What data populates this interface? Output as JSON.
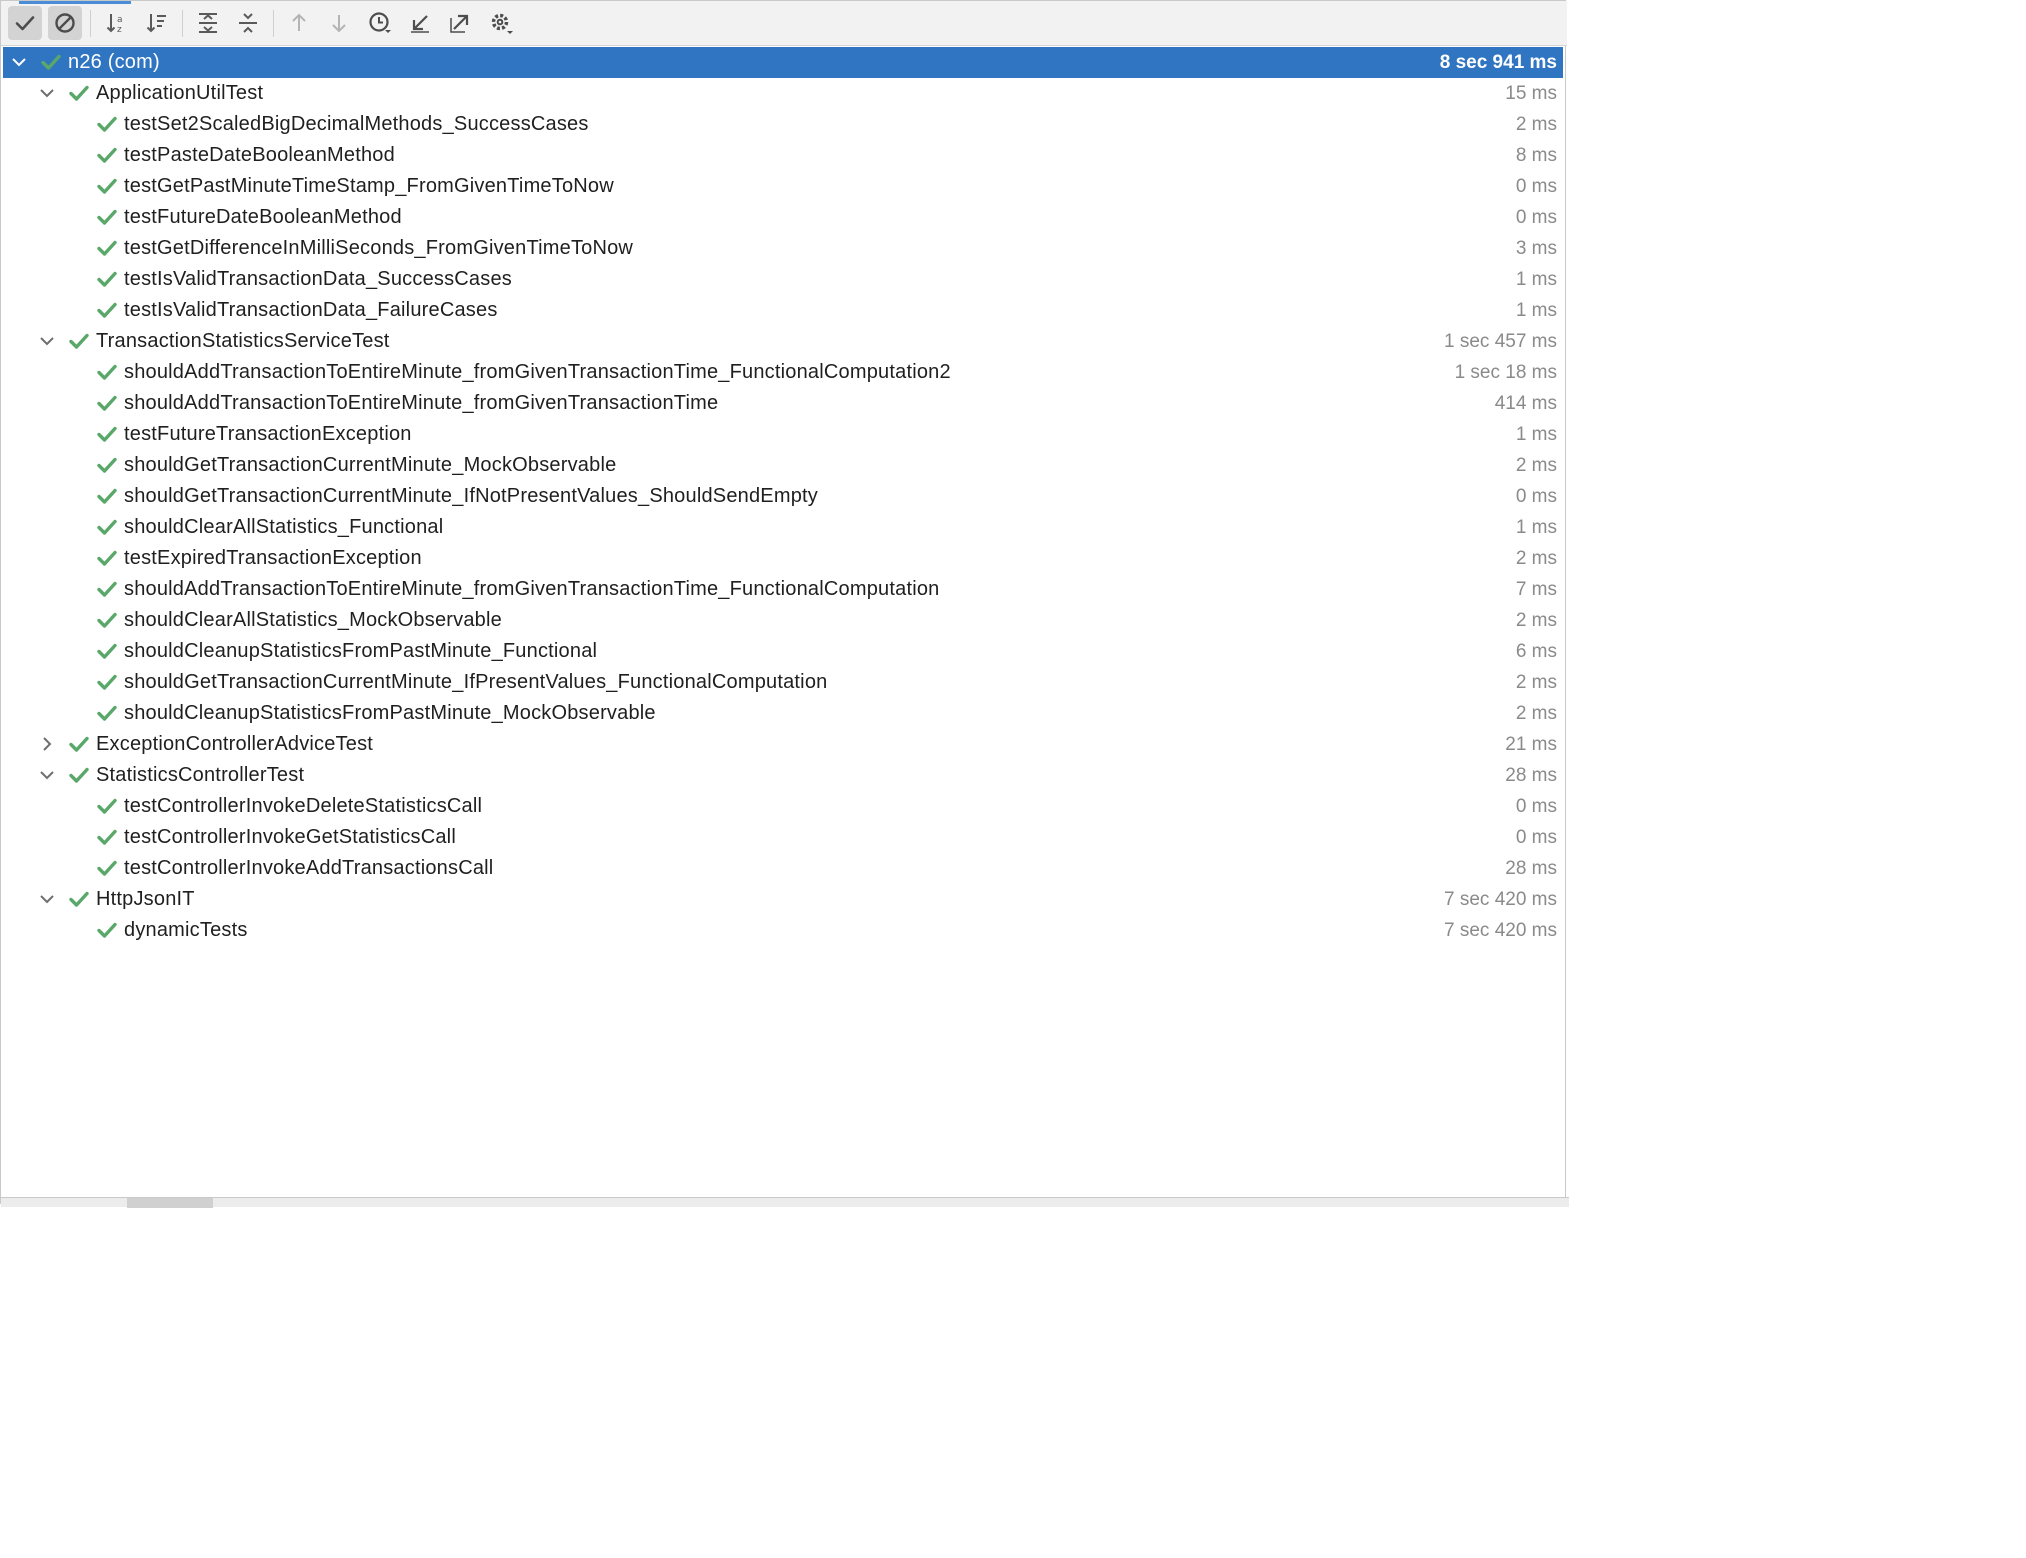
{
  "toolbar": {
    "buttons": [
      {
        "icon": "show-passed-icon",
        "active": true
      },
      {
        "icon": "show-ignored-icon",
        "active": true
      },
      {
        "icon": "sort-alphabetically-icon",
        "active": false
      },
      {
        "icon": "sort-by-duration-icon",
        "active": false
      },
      {
        "icon": "expand-all-icon",
        "active": false
      },
      {
        "icon": "collapse-all-icon",
        "active": false
      },
      {
        "icon": "previous-failed-test-icon",
        "active": false
      },
      {
        "icon": "next-failed-test-icon",
        "active": false
      },
      {
        "icon": "test-history-icon",
        "active": false
      },
      {
        "icon": "import-tests-icon",
        "active": false
      },
      {
        "icon": "export-test-results-icon",
        "active": false
      },
      {
        "icon": "settings-gear-icon",
        "active": false
      }
    ]
  },
  "colors": {
    "pass_green": "#59a869",
    "selection_blue": "#2f75c1",
    "duration_gray": "#8a8a8a"
  },
  "tests": {
    "root": {
      "label": "n26 (com)",
      "duration": "8 sec 941 ms"
    },
    "suites": [
      {
        "label": "ApplicationUtilTest",
        "duration": "15 ms",
        "expanded": true,
        "tests": [
          {
            "label": "testSet2ScaledBigDecimalMethods_SuccessCases",
            "duration": "2 ms"
          },
          {
            "label": "testPasteDateBooleanMethod",
            "duration": "8 ms"
          },
          {
            "label": "testGetPastMinuteTimeStamp_FromGivenTimeToNow",
            "duration": "0 ms"
          },
          {
            "label": "testFutureDateBooleanMethod",
            "duration": "0 ms"
          },
          {
            "label": "testGetDifferenceInMilliSeconds_FromGivenTimeToNow",
            "duration": "3 ms"
          },
          {
            "label": "testIsValidTransactionData_SuccessCases",
            "duration": "1 ms"
          },
          {
            "label": "testIsValidTransactionData_FailureCases",
            "duration": "1 ms"
          }
        ]
      },
      {
        "label": "TransactionStatisticsServiceTest",
        "duration": "1 sec 457 ms",
        "expanded": true,
        "tests": [
          {
            "label": "shouldAddTransactionToEntireMinute_fromGivenTransactionTime_FunctionalComputation2",
            "duration": "1 sec 18 ms"
          },
          {
            "label": "shouldAddTransactionToEntireMinute_fromGivenTransactionTime",
            "duration": "414 ms"
          },
          {
            "label": "testFutureTransactionException",
            "duration": "1 ms"
          },
          {
            "label": "shouldGetTransactionCurrentMinute_MockObservable",
            "duration": "2 ms"
          },
          {
            "label": "shouldGetTransactionCurrentMinute_IfNotPresentValues_ShouldSendEmpty",
            "duration": "0 ms"
          },
          {
            "label": "shouldClearAllStatistics_Functional",
            "duration": "1 ms"
          },
          {
            "label": "testExpiredTransactionException",
            "duration": "2 ms"
          },
          {
            "label": "shouldAddTransactionToEntireMinute_fromGivenTransactionTime_FunctionalComputation",
            "duration": "7 ms"
          },
          {
            "label": "shouldClearAllStatistics_MockObservable",
            "duration": "2 ms"
          },
          {
            "label": "shouldCleanupStatisticsFromPastMinute_Functional",
            "duration": "6 ms"
          },
          {
            "label": "shouldGetTransactionCurrentMinute_IfPresentValues_FunctionalComputation",
            "duration": "2 ms"
          },
          {
            "label": "shouldCleanupStatisticsFromPastMinute_MockObservable",
            "duration": "2 ms"
          }
        ]
      },
      {
        "label": "ExceptionControllerAdviceTest",
        "duration": "21 ms",
        "expanded": false,
        "tests": []
      },
      {
        "label": "StatisticsControllerTest",
        "duration": "28 ms",
        "expanded": true,
        "tests": [
          {
            "label": "testControllerInvokeDeleteStatisticsCall",
            "duration": "0 ms"
          },
          {
            "label": "testControllerInvokeGetStatisticsCall",
            "duration": "0 ms"
          },
          {
            "label": "testControllerInvokeAddTransactionsCall",
            "duration": "28 ms"
          }
        ]
      },
      {
        "label": "HttpJsonIT",
        "duration": "7 sec 420 ms",
        "expanded": true,
        "tests": [
          {
            "label": "dynamicTests",
            "duration": "7 sec 420 ms"
          }
        ]
      }
    ]
  }
}
